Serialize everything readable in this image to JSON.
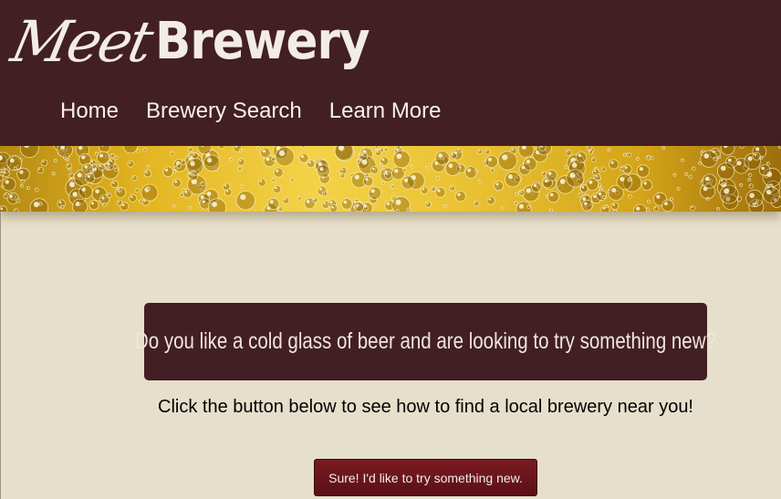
{
  "brand": {
    "script_part": "Meet",
    "bold_part": "Brewery"
  },
  "nav": {
    "items": [
      {
        "label": "Home"
      },
      {
        "label": "Brewery Search"
      },
      {
        "label": "Learn More"
      }
    ]
  },
  "banner": {
    "icon": "beer-bubbles-banner"
  },
  "main": {
    "question": "Do you like a cold glass of beer and are looking to try something new?",
    "instruction": "Click the button below to see how to find a local brewery near you!",
    "cta_label": "Sure! I'd like to try something new."
  },
  "colors": {
    "header_bg": "#421f24",
    "page_bg": "#e6dfcb",
    "button_bg": "#6b141b",
    "banner_gold": "#e9c233"
  }
}
